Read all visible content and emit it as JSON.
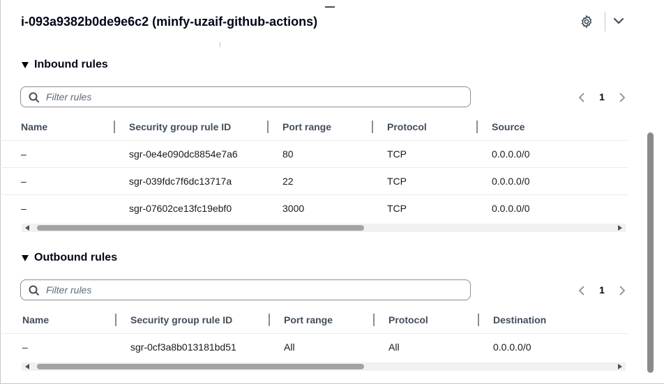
{
  "header": {
    "title": "i-093a9382b0de9e6c2 (minfy-uzaif-github-actions)"
  },
  "inbound": {
    "title": "Inbound rules",
    "filter_placeholder": "Filter rules",
    "page": "1",
    "columns": [
      "Name",
      "Security group rule ID",
      "Port range",
      "Protocol",
      "Source"
    ],
    "rows": [
      [
        "–",
        "sgr-0e4e090dc8854e7a6",
        "80",
        "TCP",
        "0.0.0.0/0"
      ],
      [
        "–",
        "sgr-039fdc7f6dc13717a",
        "22",
        "TCP",
        "0.0.0.0/0"
      ],
      [
        "–",
        "sgr-07602ce13fc19ebf0",
        "3000",
        "TCP",
        "0.0.0.0/0"
      ]
    ],
    "scroll_fraction": 0.57
  },
  "outbound": {
    "title": "Outbound rules",
    "filter_placeholder": "Filter rules",
    "page": "1",
    "columns": [
      "Name",
      "Security group rule ID",
      "Port range",
      "Protocol",
      "Destination"
    ],
    "rows": [
      [
        "–",
        "sgr-0cf3a8b013181bd51",
        "All",
        "All",
        "0.0.0.0/0"
      ]
    ],
    "scroll_fraction": 0.57
  },
  "icons": {
    "settings": "gear-icon",
    "collapse": "chevron-down-icon",
    "section_caret": "caret-down-icon",
    "search": "search-icon",
    "prev": "chevron-left-icon",
    "next": "chevron-right-icon"
  },
  "colors": {
    "text_primary": "#000716",
    "text_secondary": "#414d5c",
    "border": "#8c8c94",
    "pager_disabled": "#8c8c94"
  }
}
